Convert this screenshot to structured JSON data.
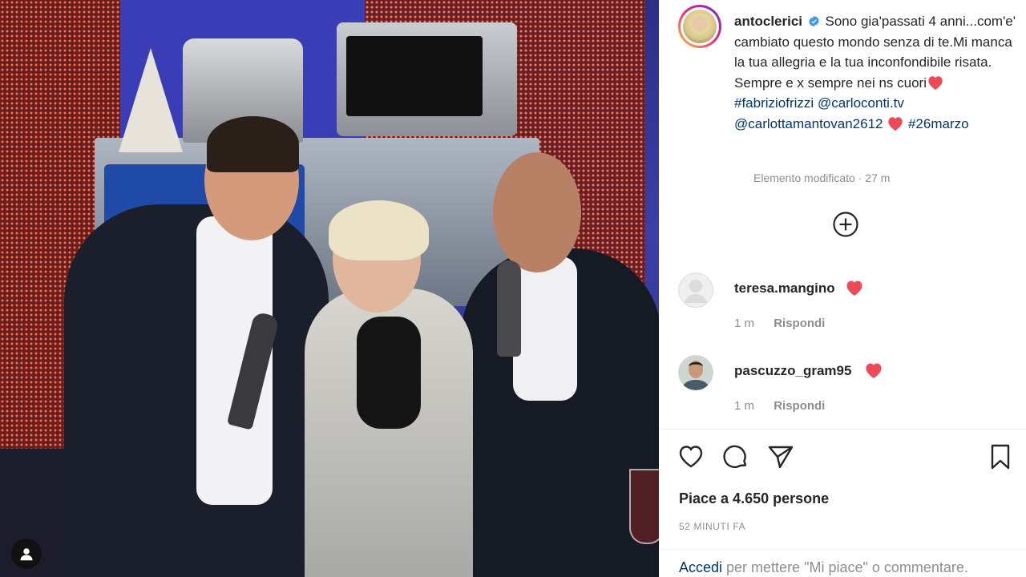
{
  "post": {
    "username": "antoclerici",
    "caption_text": "Sono gia'passati 4 anni...com'e' cambiato questo mondo senza di te.Mi manca la tua allegria e la tua inconfondibile risata. Sempre e x sempre nei ns cuori",
    "hashtag_1": "#fabriziofrizzi",
    "mention_1": "@carloconti.tv",
    "mention_2": "@carlottamantovan2612",
    "hashtag_2": "#26marzo",
    "edited_label": "Elemento modificato",
    "edited_sep": " · ",
    "edited_time": "27 m"
  },
  "comments": [
    {
      "username": "teresa.mangino",
      "time": "1 m",
      "reply_label": "Rispondi",
      "avatar_icon": "default-avatar-icon"
    },
    {
      "username": "pascuzzo_gram95",
      "time": "1 m",
      "reply_label": "Rispondi",
      "avatar_icon": "user-photo"
    }
  ],
  "likes_text": "Piace a 4.650 persone",
  "time_ago": "52 minuti fa",
  "login": {
    "link": "Accedi",
    "rest": " per mettere \"Mi piace\" o commentare."
  },
  "icons": {
    "verified": "verified-badge-icon",
    "more": "plus-circle-icon",
    "like": "heart-outline-icon",
    "comment": "comment-bubble-icon",
    "share": "paper-plane-icon",
    "save": "bookmark-icon",
    "profile": "user-silhouette-icon"
  },
  "colors": {
    "link": "#00376b",
    "heart_red": "#ed4956",
    "verified_blue": "#3897f0",
    "muted": "#8e8e8e"
  }
}
